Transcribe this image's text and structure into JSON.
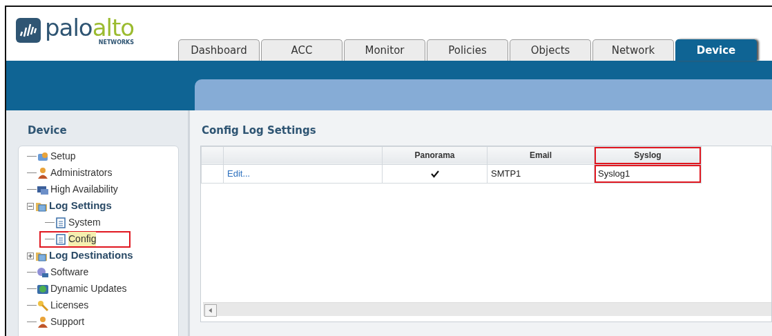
{
  "logo": {
    "word_1": "palo",
    "word_2": "alto",
    "tagline": "NETWORKS"
  },
  "tabs": [
    {
      "label": "Dashboard",
      "selected": false
    },
    {
      "label": "ACC",
      "selected": false
    },
    {
      "label": "Monitor",
      "selected": false
    },
    {
      "label": "Policies",
      "selected": false
    },
    {
      "label": "Objects",
      "selected": false
    },
    {
      "label": "Network",
      "selected": false
    },
    {
      "label": "Device",
      "selected": true
    }
  ],
  "sidebar": {
    "title": "Device",
    "items": [
      {
        "label": "Setup",
        "kind": "tools",
        "bold": false,
        "selected": false
      },
      {
        "label": "Administrators",
        "kind": "person",
        "bold": false,
        "selected": false
      },
      {
        "label": "High Availability",
        "kind": "monitor",
        "bold": false,
        "selected": false
      },
      {
        "label": "Log Settings",
        "kind": "folder",
        "bold": true,
        "selected": false,
        "expanded": true,
        "children": [
          {
            "label": "System",
            "kind": "page",
            "bold": false,
            "selected": false
          },
          {
            "label": "Config",
            "kind": "page",
            "bold": false,
            "selected": true,
            "highlighted": true
          }
        ]
      },
      {
        "label": "Log Destinations",
        "kind": "folder",
        "bold": true,
        "selected": false,
        "expanded": false
      },
      {
        "label": "Software",
        "kind": "disc",
        "bold": false,
        "selected": false
      },
      {
        "label": "Dynamic Updates",
        "kind": "globe",
        "bold": false,
        "selected": false
      },
      {
        "label": "Licenses",
        "kind": "key",
        "bold": false,
        "selected": false
      },
      {
        "label": "Support",
        "kind": "person",
        "bold": false,
        "selected": false
      }
    ]
  },
  "content": {
    "title": "Config Log Settings",
    "table": {
      "columns": [
        {
          "label": "Panorama",
          "highlighted": false
        },
        {
          "label": "Email",
          "highlighted": false
        },
        {
          "label": "Syslog",
          "highlighted": true
        }
      ],
      "rows": [
        {
          "action": "Edit...",
          "panorama": true,
          "email": "SMTP1",
          "syslog": "Syslog1"
        }
      ]
    }
  }
}
